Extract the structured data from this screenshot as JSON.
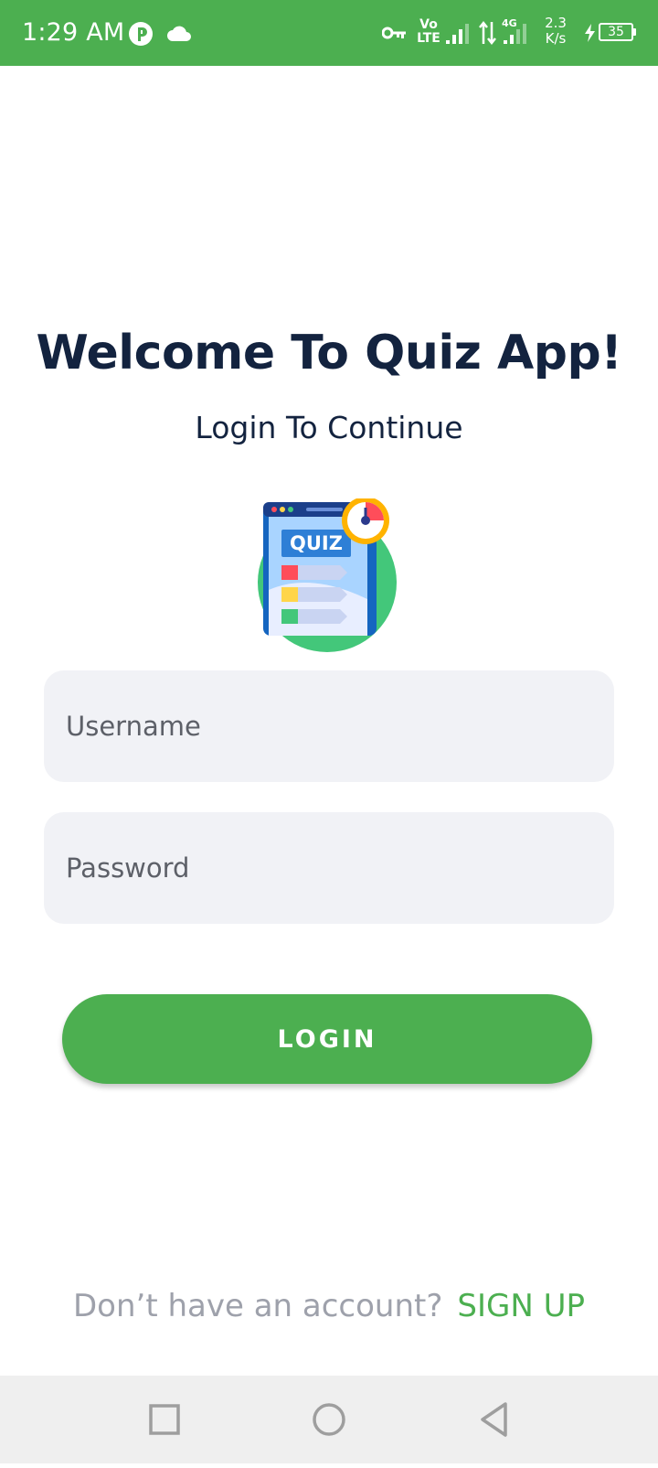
{
  "status_bar": {
    "time": "1:29 AM",
    "network_speed_value": "2.3",
    "network_speed_unit": "K/s",
    "volte_top": "Vo",
    "volte_bottom": "LTE",
    "network_type": "4G",
    "battery_level": "35",
    "background_color": "#4caf50",
    "icons": [
      "pinterest-icon",
      "cloud-icon",
      "vpn-key-icon",
      "volte-icon",
      "signal-icon",
      "data-arrows-icon",
      "signal-4g-icon",
      "charging-icon",
      "battery-icon"
    ]
  },
  "main": {
    "title": "Welcome To Quiz App!",
    "subtitle": "Login To Continue",
    "logo_icon": "quiz-logo-icon",
    "logo_text": "QUIZ",
    "username_placeholder": "Username",
    "password_placeholder": "Password",
    "login_label": "LOGIN",
    "signup_prompt": "Don’t have an account?",
    "signup_link": "SIGN UP",
    "accent_color": "#4caf50",
    "title_color": "#13233f"
  },
  "nav_bar": {
    "items": [
      "recents-button",
      "home-button",
      "back-button"
    ]
  }
}
